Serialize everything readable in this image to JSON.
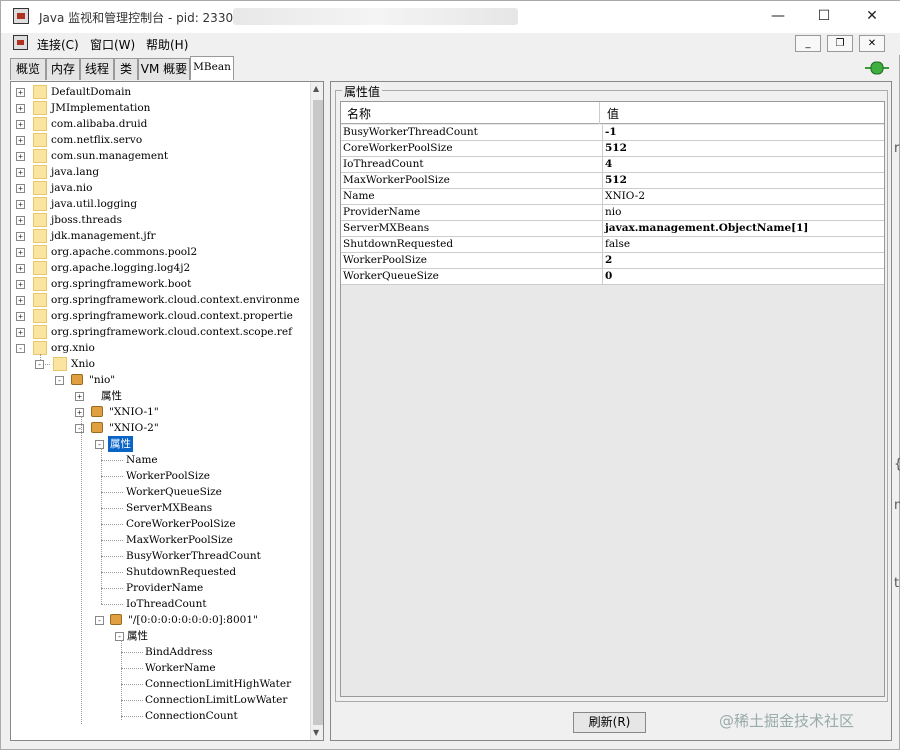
{
  "window": {
    "title": "Java 监视和管理控制台 - pid: 23304",
    "min_icon": "minimize-icon",
    "max_icon": "maximize-icon",
    "close_icon": "close-icon"
  },
  "menu": {
    "items": [
      "连接(C)",
      "窗口(W)",
      "帮助(H)"
    ]
  },
  "tabs": [
    "概览",
    "内存",
    "线程",
    "类",
    "VM 概要",
    "MBean"
  ],
  "active_tab": "MBean",
  "tree": {
    "domains": [
      "DefaultDomain",
      "JMImplementation",
      "com.alibaba.druid",
      "com.netflix.servo",
      "com.sun.management",
      "java.lang",
      "java.nio",
      "java.util.logging",
      "jboss.threads",
      "jdk.management.jfr",
      "org.apache.commons.pool2",
      "org.apache.logging.log4j2",
      "org.springframework.boot",
      "org.springframework.cloud.context.environme",
      "org.springframework.cloud.context.propertie",
      "org.springframework.cloud.context.scope.ref",
      "org.xnio"
    ],
    "xnio": "Xnio",
    "nio": "\"nio\"",
    "attr_label": "属性",
    "xnio1": "\"XNIO-1\"",
    "xnio2": "\"XNIO-2\"",
    "xnio2_attrs": [
      "Name",
      "WorkerPoolSize",
      "WorkerQueueSize",
      "ServerMXBeans",
      "CoreWorkerPoolSize",
      "MaxWorkerPoolSize",
      "BusyWorkerThreadCount",
      "ShutdownRequested",
      "ProviderName",
      "IoThreadCount"
    ],
    "server_node": "\"/[0:0:0:0:0:0:0:0]:8001\"",
    "server_attrs": [
      "BindAddress",
      "WorkerName",
      "ConnectionLimitHighWater",
      "ConnectionLimitLowWater",
      "ConnectionCount"
    ]
  },
  "panel": {
    "legend": "属性值",
    "col_name": "名称",
    "col_value": "值",
    "rows": [
      {
        "name": "BusyWorkerThreadCount",
        "value": "-1",
        "bold": true
      },
      {
        "name": "CoreWorkerPoolSize",
        "value": "512",
        "bold": true
      },
      {
        "name": "IoThreadCount",
        "value": "4",
        "bold": true
      },
      {
        "name": "MaxWorkerPoolSize",
        "value": "512",
        "bold": true
      },
      {
        "name": "Name",
        "value": "XNIO-2",
        "bold": false
      },
      {
        "name": "ProviderName",
        "value": "nio",
        "bold": false
      },
      {
        "name": "ServerMXBeans",
        "value": "javax.management.ObjectName[1]",
        "bold": true
      },
      {
        "name": "ShutdownRequested",
        "value": "false",
        "bold": false
      },
      {
        "name": "WorkerPoolSize",
        "value": "2",
        "bold": true
      },
      {
        "name": "WorkerQueueSize",
        "value": "0",
        "bold": true
      }
    ],
    "refresh": "刷新(R)"
  },
  "watermark": "@稀土掘金技术社区"
}
